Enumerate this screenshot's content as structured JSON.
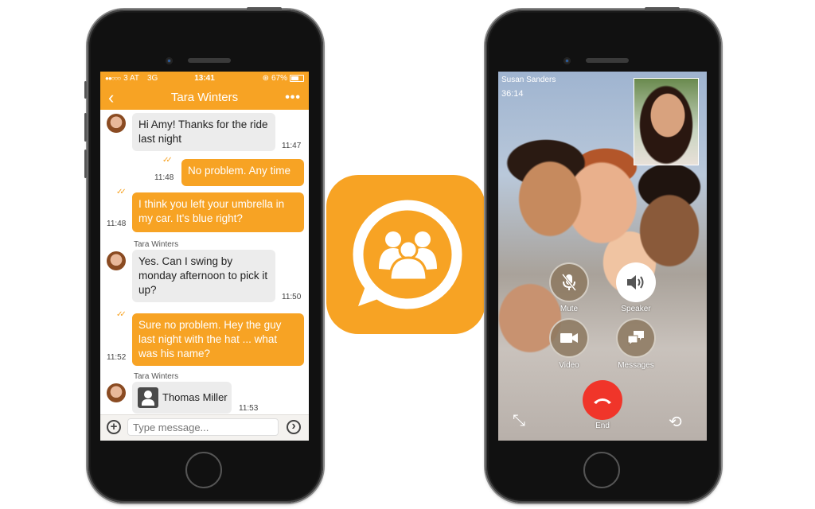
{
  "chat_phone": {
    "status_bar": {
      "signal": "●●○○○",
      "carrier": "3 AT",
      "network": "3G",
      "time": "13:41",
      "battery": "67%"
    },
    "nav": {
      "back_icon": "chevron-left-icon",
      "title": "Tara Winters",
      "more_icon": "more-icon"
    },
    "messages": [
      {
        "direction": "in",
        "text": "Hi Amy! Thanks for the ride last night",
        "time": "11:47"
      },
      {
        "direction": "out",
        "text": "No problem. Any time",
        "time": "11:48",
        "status": "read"
      },
      {
        "direction": "out",
        "text": "I think you left your umbrella in my car. It's blue right?",
        "time": "11:48",
        "status": "read"
      },
      {
        "direction": "in",
        "sender": "Tara Winters",
        "text": "Yes. Can I swing by monday afternoon to pick it up?",
        "time": "11:50"
      },
      {
        "direction": "out",
        "text": "Sure no problem. Hey the guy last night with the hat ... what was his name?",
        "time": "11:52",
        "status": "read"
      },
      {
        "direction": "in",
        "sender": "Tara Winters",
        "type": "contact",
        "text": "Thomas Miller",
        "time": "11:53"
      }
    ],
    "input": {
      "placeholder": "Type message...",
      "value": ""
    },
    "ticks": "✓✓",
    "add_label": "+",
    "send_label": "›"
  },
  "app_icon": {
    "name": "group-chat-app-icon",
    "color": "#f7a324"
  },
  "call_phone": {
    "caller": "Susan Sanders",
    "duration": "36:14",
    "buttons": [
      {
        "id": "mute",
        "label": "Mute",
        "icon": "mic-off-icon"
      },
      {
        "id": "speaker",
        "label": "Speaker",
        "icon": "speaker-icon",
        "active": true
      },
      {
        "id": "video",
        "label": "Video",
        "icon": "video-camera-icon"
      },
      {
        "id": "messages",
        "label": "Messages",
        "icon": "chat-bubbles-icon"
      }
    ],
    "end_label": "End",
    "minimize_icon": "minimize-icon",
    "switch_camera_icon": "switch-camera-icon"
  },
  "colors": {
    "accent": "#f7a324",
    "end_call": "#f0352a",
    "bubble_in": "#ececec"
  }
}
